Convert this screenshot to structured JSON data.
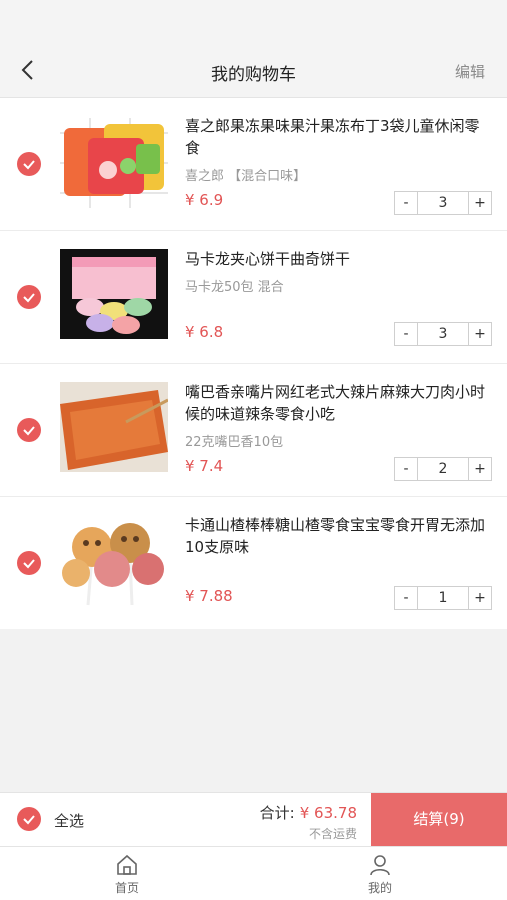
{
  "header": {
    "title": "我的购物车",
    "edit_label": "编辑",
    "back_icon": "chevron-left-icon"
  },
  "cart": {
    "items": [
      {
        "name": "喜之郎果冻果味果汁果冻布丁3袋儿童休闲零食",
        "spec": "喜之郎 【混合口味】",
        "price": "¥ 6.9",
        "qty": "3",
        "checked": true
      },
      {
        "name": "马卡龙夹心饼干曲奇饼干",
        "spec": "马卡龙50包 混合",
        "price": "¥ 6.8",
        "qty": "3",
        "checked": true
      },
      {
        "name": "嘴巴香亲嘴片网红老式大辣片麻辣大刀肉小时候的味道辣条零食小吃",
        "spec": "22克嘴巴香10包",
        "price": "¥ 7.4",
        "qty": "2",
        "checked": true
      },
      {
        "name": "卡通山楂棒棒糖山楂零食宝宝零食开胃无添加10支原味",
        "spec": "",
        "price": "¥ 7.88",
        "qty": "1",
        "checked": true
      }
    ],
    "minus_label": "-",
    "plus_label": "+"
  },
  "checkout": {
    "select_all_label": "全选",
    "total_label": "合计:",
    "total_value": "¥ 63.78",
    "shipping_note": "不含运费",
    "pay_label": "结算(9)"
  },
  "tabbar": {
    "tabs": [
      {
        "label": "首页",
        "icon": "home-icon"
      },
      {
        "label": "我的",
        "icon": "user-icon"
      }
    ]
  },
  "colors": {
    "accent": "#e85a5a",
    "price": "#e25555",
    "pay_button": "#e86a6a"
  }
}
